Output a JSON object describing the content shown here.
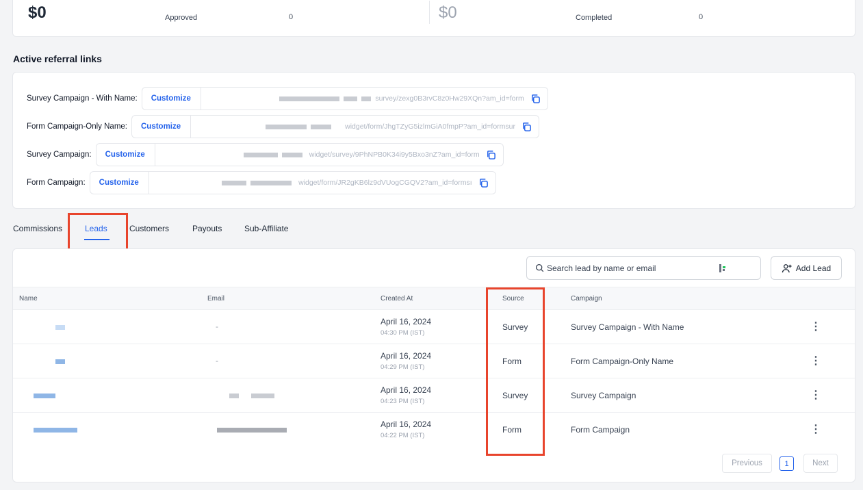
{
  "stats": [
    {
      "amount": "$0",
      "label": "Approved",
      "count": "0"
    },
    {
      "amount": "$0",
      "label": "Completed",
      "count": "0"
    }
  ],
  "referral": {
    "title": "Active referral links",
    "customize_label": "Customize",
    "links": [
      {
        "label": "Survey Campaign - With Name:",
        "url": "survey/zexg0B3rvC8z0Hw29XQn?am_id=form"
      },
      {
        "label": "Form Campaign-Only Name:",
        "url": "widget/form/JhgTZyG5izlmGiA0fmpP?am_id=formsur"
      },
      {
        "label": "Survey Campaign:",
        "url": "widget/survey/9PhNPB0K34i9y5Bxo3nZ?am_id=form"
      },
      {
        "label": "Form Campaign:",
        "url": "widget/form/JR2gKB6lz9dVUogCGQV2?am_id=formsı"
      }
    ]
  },
  "tabs": [
    "Commissions",
    "Leads",
    "Customers",
    "Payouts",
    "Sub-Affiliate"
  ],
  "leads": {
    "search_placeholder": "Search lead by name or email",
    "add_label": "Add Lead",
    "columns": [
      "Name",
      "Email",
      "Created At",
      "Source",
      "Campaign"
    ],
    "rows": [
      {
        "email": "-",
        "date": "April 16, 2024",
        "time": "04:30 PM (IST)",
        "source": "Survey",
        "campaign": "Survey Campaign - With Name"
      },
      {
        "email": "-",
        "date": "April 16, 2024",
        "time": "04:29 PM (IST)",
        "source": "Form",
        "campaign": "Form Campaign-Only Name"
      },
      {
        "email": "",
        "date": "April 16, 2024",
        "time": "04:23 PM (IST)",
        "source": "Survey",
        "campaign": "Survey Campaign"
      },
      {
        "email": "",
        "date": "April 16, 2024",
        "time": "04:22 PM (IST)",
        "source": "Form",
        "campaign": "Form Campaign"
      }
    ],
    "pagination": {
      "previous": "Previous",
      "page": "1",
      "next": "Next"
    }
  },
  "colors": {
    "accent": "#2563eb",
    "highlight": "#e8442c"
  }
}
